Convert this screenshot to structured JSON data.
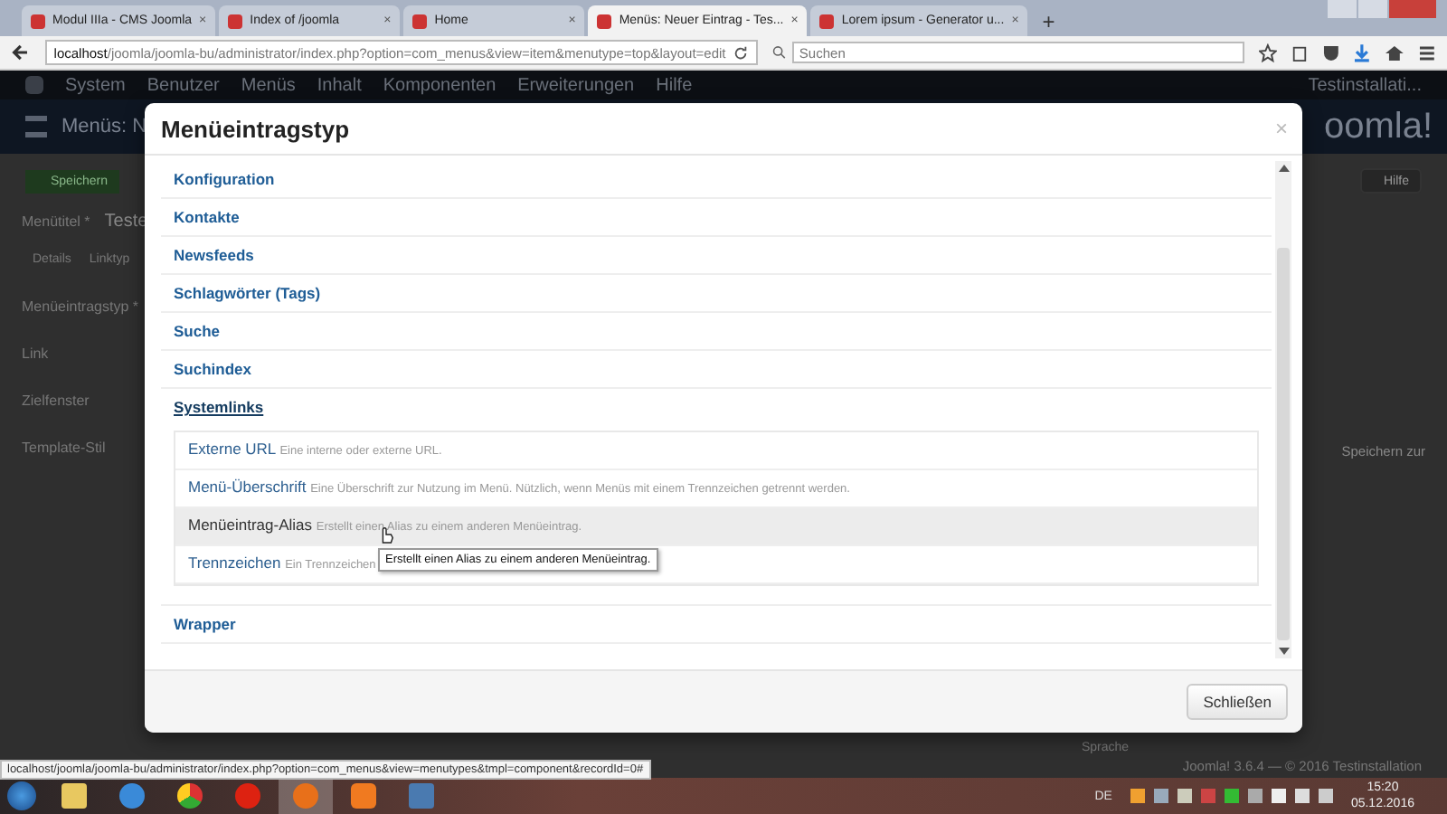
{
  "browser": {
    "tabs": [
      {
        "title": "Modul IIIa - CMS Joomla",
        "selected": false,
        "close": "×"
      },
      {
        "title": "Index of /joomla",
        "selected": false,
        "close": "×"
      },
      {
        "title": "Home",
        "selected": false,
        "close": "×"
      },
      {
        "title": "Menüs: Neuer Eintrag - Tes...",
        "selected": true,
        "close": "×"
      },
      {
        "title": "Lorem ipsum - Generator u...",
        "selected": false,
        "close": "×"
      }
    ],
    "new_tab": "+",
    "url": {
      "host": "localhost",
      "path": "/joomla/joomla-bu/administrator/index.php?option=com_menus&view=item&menutype=top&layout=edit"
    },
    "search": {
      "placeholder": "Suchen"
    }
  },
  "admin": {
    "menu": [
      "System",
      "Benutzer",
      "Menüs",
      "Inhalt",
      "Komponenten",
      "Erweiterungen",
      "Hilfe"
    ],
    "site_name": "Testinstallati...",
    "page_title": "Menüs: N",
    "logo_text": "oomla!",
    "save_button": "Speichern",
    "help_button": "Hilfe",
    "title_label": "Menütitel *",
    "title_value": "Teste",
    "tabs": [
      "Details",
      "Linktyp"
    ],
    "labels": [
      "Menüeintragstyp *",
      "Link",
      "Zielfenster",
      "Template-Stil"
    ],
    "side_text": "Speichern zur",
    "bottom_label": "Sprache",
    "footer": "Joomla! 3.6.4 — © 2016 Testinstallation"
  },
  "modal": {
    "title": "Menüeintragstyp",
    "close": "×",
    "groups": [
      {
        "label": "Konfiguration",
        "expanded": false
      },
      {
        "label": "Kontakte",
        "expanded": false
      },
      {
        "label": "Newsfeeds",
        "expanded": false
      },
      {
        "label": "Schlagwörter (Tags)",
        "expanded": false
      },
      {
        "label": "Suche",
        "expanded": false
      },
      {
        "label": "Suchindex",
        "expanded": false
      },
      {
        "label": "Systemlinks",
        "expanded": true,
        "items": [
          {
            "title": "Externe URL",
            "description": "Eine interne oder externe URL.",
            "highlighted": false
          },
          {
            "title": "Menü-Überschrift",
            "description": "Eine Überschrift zur Nutzung im Menü. Nützlich, wenn Menüs mit einem Trennzeichen getrennt werden.",
            "highlighted": false
          },
          {
            "title": "Menüeintrag-Alias",
            "description": "Erstellt einen Alias zu einem anderen Menüeintrag.",
            "highlighted": true
          },
          {
            "title": "Trennzeichen",
            "description": "Ein Trennzeichen",
            "highlighted": false
          }
        ]
      },
      {
        "label": "Wrapper",
        "expanded": false
      }
    ],
    "tooltip": "Erstellt einen Alias zu einem anderen Menüeintrag.",
    "close_button": "Schließen"
  },
  "status_url": "localhost/joomla/joomla-bu/administrator/index.php?option=com_menus&view=menutypes&tmpl=component&recordId=0#",
  "taskbar": {
    "language": "DE",
    "time": "15:20",
    "date": "05.12.2016"
  }
}
